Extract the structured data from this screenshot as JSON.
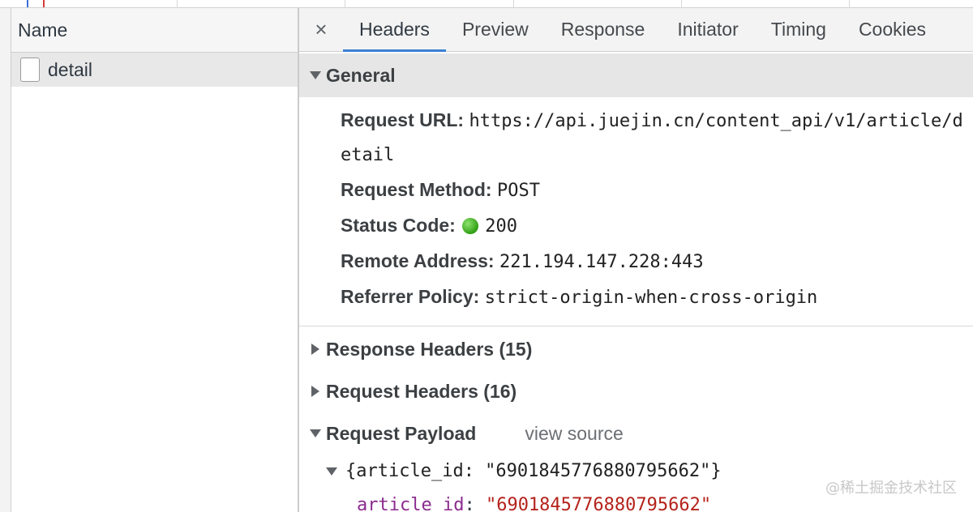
{
  "name_panel": {
    "header": "Name",
    "rows": [
      {
        "label": "detail"
      }
    ]
  },
  "tabs": {
    "close_label": "×",
    "items": [
      "Headers",
      "Preview",
      "Response",
      "Initiator",
      "Timing",
      "Cookies"
    ],
    "active": "Headers"
  },
  "general": {
    "title": "General",
    "request_url_label": "Request URL:",
    "request_url": "https://api.juejin.cn/content_api/v1/article/detail",
    "request_method_label": "Request Method:",
    "request_method": "POST",
    "status_code_label": "Status Code:",
    "status_code": "200",
    "remote_address_label": "Remote Address:",
    "remote_address": "221.194.147.228:443",
    "referrer_policy_label": "Referrer Policy:",
    "referrer_policy": "strict-origin-when-cross-origin"
  },
  "sections": {
    "response_headers": "Response Headers (15)",
    "request_headers": "Request Headers (16)",
    "request_payload": "Request Payload",
    "view_source": "view source"
  },
  "payload": {
    "summary": "{article_id: \"6901845776880795662\"}",
    "key": "article_id",
    "colon": ": ",
    "value": "\"6901845776880795662\""
  },
  "watermark": "@稀土掘金技术社区",
  "colors": {
    "active_tab_underline": "#3c7fd5",
    "status_ok": "#2f9e13",
    "json_key": "#8b2b8e",
    "json_string": "#b4221b"
  }
}
